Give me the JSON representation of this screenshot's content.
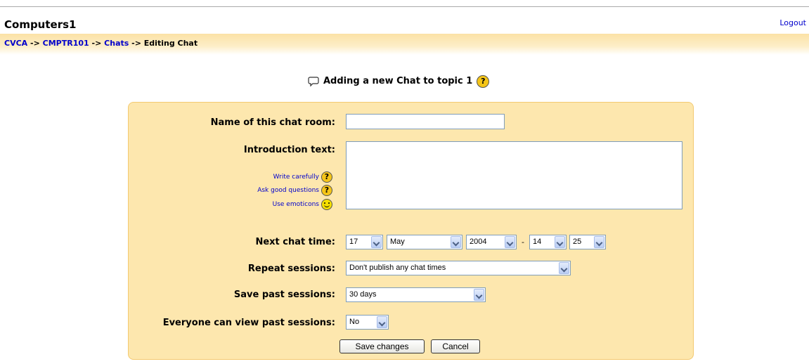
{
  "header": {
    "site_title": "Computers1",
    "logout_label": "Logout"
  },
  "breadcrumb": {
    "items": [
      "CVCA",
      "CMPTR101",
      "Chats"
    ],
    "separator": "->",
    "current": "Editing Chat"
  },
  "page": {
    "heading": "Adding a new Chat to topic 1"
  },
  "form": {
    "name_label": "Name of this chat room:",
    "name_value": "",
    "intro_label": "Introduction text:",
    "intro_value": "",
    "help_links": [
      "Write carefully",
      "Ask good questions",
      "Use emoticons"
    ],
    "next_time_label": "Next chat time:",
    "day": "17",
    "month": "May",
    "year": "2004",
    "time_sep": "-",
    "hour": "14",
    "minute": "25",
    "repeat_label": "Repeat sessions:",
    "repeat_value": "Don't publish any chat times",
    "save_label": "Save past sessions:",
    "save_value": "30 days",
    "view_label": "Everyone can view past sessions:",
    "view_value": "No"
  },
  "buttons": {
    "save": "Save changes",
    "cancel": "Cancel"
  },
  "colors": {
    "link": "#0000cc",
    "panel_bg": "#fde7ae",
    "nav_bg": "#fbe2a6"
  }
}
